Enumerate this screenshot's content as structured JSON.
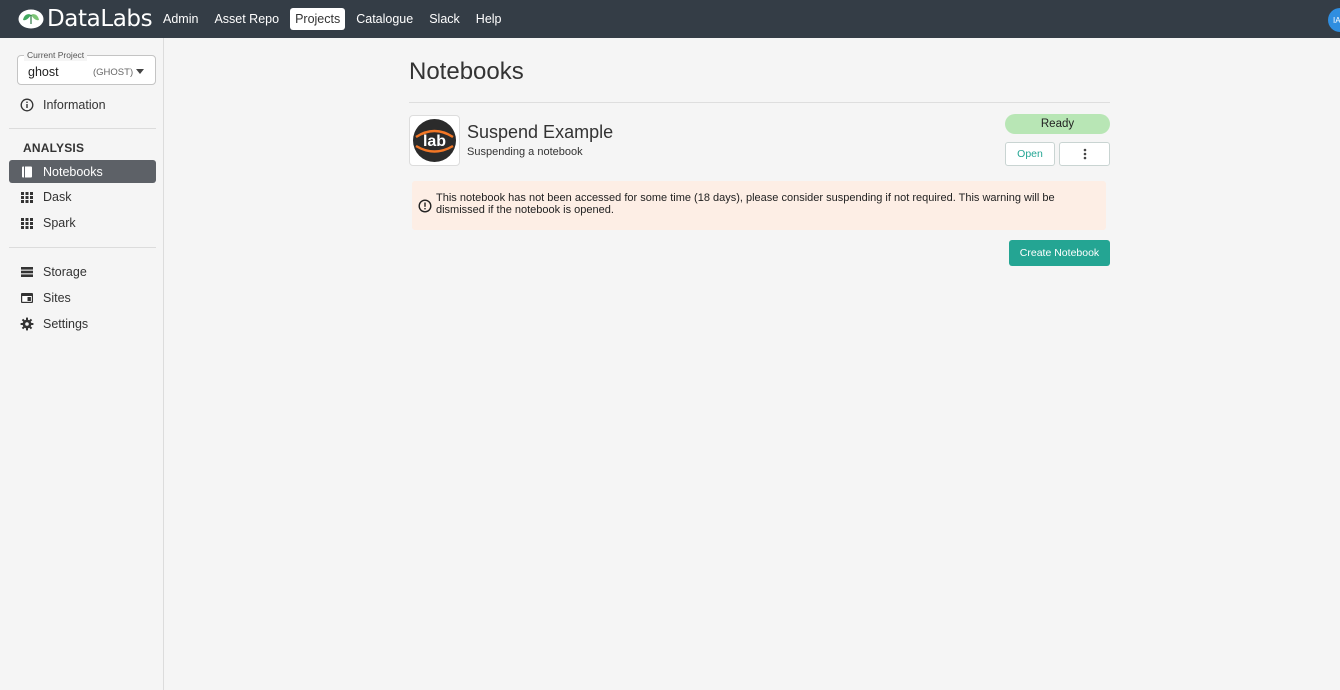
{
  "brand": {
    "name": "DataLabs"
  },
  "nav": {
    "items": [
      {
        "label": "Admin",
        "active": false
      },
      {
        "label": "Asset Repo",
        "active": false
      },
      {
        "label": "Projects",
        "active": true
      },
      {
        "label": "Catalogue",
        "active": false
      },
      {
        "label": "Slack",
        "active": false
      },
      {
        "label": "Help",
        "active": false
      }
    ]
  },
  "user": {
    "initials": "IA"
  },
  "sidebar": {
    "project_select": {
      "label": "Current Project",
      "value": "ghost",
      "key": "(GHOST)"
    },
    "information": "Information",
    "analysis_heading": "ANALYSIS",
    "analysis_items": [
      {
        "label": "Notebooks",
        "icon": "notebook-icon",
        "active": true
      },
      {
        "label": "Dask",
        "icon": "grid-icon",
        "active": false
      },
      {
        "label": "Spark",
        "icon": "grid-icon",
        "active": false
      }
    ],
    "other_items": [
      {
        "label": "Storage",
        "icon": "storage-icon"
      },
      {
        "label": "Sites",
        "icon": "sites-icon"
      },
      {
        "label": "Settings",
        "icon": "gear-icon"
      }
    ]
  },
  "main": {
    "title": "Notebooks",
    "notebook": {
      "logo_text": "lab",
      "name": "Suspend Example",
      "description": "Suspending a notebook",
      "status": "Ready",
      "open_label": "Open"
    },
    "warning": "This notebook has not been accessed for some time (18 days), please consider suspending if not required. This warning will be dismissed if the notebook is opened.",
    "create_label": "Create Notebook"
  },
  "colors": {
    "topbar": "#343d46",
    "accent": "#24a593",
    "status_ready": "#b8e6b5",
    "warning_bg": "#fdeee5",
    "jupyter_orange": "#f37726"
  }
}
